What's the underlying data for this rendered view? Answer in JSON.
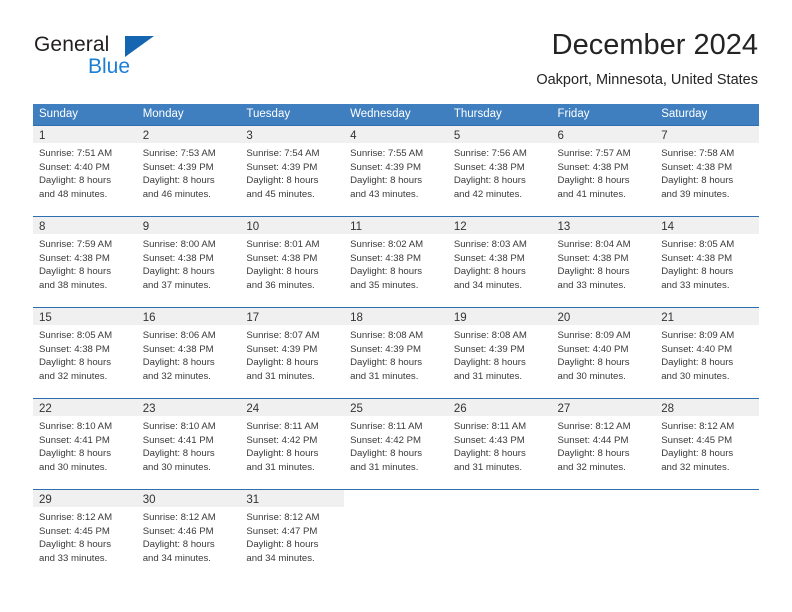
{
  "brand": {
    "name_part1": "General",
    "name_part2": "Blue",
    "triangle_icon": "triangle-logo-icon",
    "color_primary": "#1565b0",
    "color_secondary": "#1b7fd4"
  },
  "header": {
    "title": "December 2024",
    "location": "Oakport, Minnesota, United States"
  },
  "calendar": {
    "accent_color": "#3f7fbf",
    "daynum_bg": "#f0f0f0",
    "weekday_headers": [
      "Sunday",
      "Monday",
      "Tuesday",
      "Wednesday",
      "Thursday",
      "Friday",
      "Saturday"
    ],
    "weeks": [
      [
        {
          "day": "1",
          "sunrise": "Sunrise: 7:51 AM",
          "sunset": "Sunset: 4:40 PM",
          "daylight_line1": "Daylight: 8 hours",
          "daylight_line2": "and 48 minutes."
        },
        {
          "day": "2",
          "sunrise": "Sunrise: 7:53 AM",
          "sunset": "Sunset: 4:39 PM",
          "daylight_line1": "Daylight: 8 hours",
          "daylight_line2": "and 46 minutes."
        },
        {
          "day": "3",
          "sunrise": "Sunrise: 7:54 AM",
          "sunset": "Sunset: 4:39 PM",
          "daylight_line1": "Daylight: 8 hours",
          "daylight_line2": "and 45 minutes."
        },
        {
          "day": "4",
          "sunrise": "Sunrise: 7:55 AM",
          "sunset": "Sunset: 4:39 PM",
          "daylight_line1": "Daylight: 8 hours",
          "daylight_line2": "and 43 minutes."
        },
        {
          "day": "5",
          "sunrise": "Sunrise: 7:56 AM",
          "sunset": "Sunset: 4:38 PM",
          "daylight_line1": "Daylight: 8 hours",
          "daylight_line2": "and 42 minutes."
        },
        {
          "day": "6",
          "sunrise": "Sunrise: 7:57 AM",
          "sunset": "Sunset: 4:38 PM",
          "daylight_line1": "Daylight: 8 hours",
          "daylight_line2": "and 41 minutes."
        },
        {
          "day": "7",
          "sunrise": "Sunrise: 7:58 AM",
          "sunset": "Sunset: 4:38 PM",
          "daylight_line1": "Daylight: 8 hours",
          "daylight_line2": "and 39 minutes."
        }
      ],
      [
        {
          "day": "8",
          "sunrise": "Sunrise: 7:59 AM",
          "sunset": "Sunset: 4:38 PM",
          "daylight_line1": "Daylight: 8 hours",
          "daylight_line2": "and 38 minutes."
        },
        {
          "day": "9",
          "sunrise": "Sunrise: 8:00 AM",
          "sunset": "Sunset: 4:38 PM",
          "daylight_line1": "Daylight: 8 hours",
          "daylight_line2": "and 37 minutes."
        },
        {
          "day": "10",
          "sunrise": "Sunrise: 8:01 AM",
          "sunset": "Sunset: 4:38 PM",
          "daylight_line1": "Daylight: 8 hours",
          "daylight_line2": "and 36 minutes."
        },
        {
          "day": "11",
          "sunrise": "Sunrise: 8:02 AM",
          "sunset": "Sunset: 4:38 PM",
          "daylight_line1": "Daylight: 8 hours",
          "daylight_line2": "and 35 minutes."
        },
        {
          "day": "12",
          "sunrise": "Sunrise: 8:03 AM",
          "sunset": "Sunset: 4:38 PM",
          "daylight_line1": "Daylight: 8 hours",
          "daylight_line2": "and 34 minutes."
        },
        {
          "day": "13",
          "sunrise": "Sunrise: 8:04 AM",
          "sunset": "Sunset: 4:38 PM",
          "daylight_line1": "Daylight: 8 hours",
          "daylight_line2": "and 33 minutes."
        },
        {
          "day": "14",
          "sunrise": "Sunrise: 8:05 AM",
          "sunset": "Sunset: 4:38 PM",
          "daylight_line1": "Daylight: 8 hours",
          "daylight_line2": "and 33 minutes."
        }
      ],
      [
        {
          "day": "15",
          "sunrise": "Sunrise: 8:05 AM",
          "sunset": "Sunset: 4:38 PM",
          "daylight_line1": "Daylight: 8 hours",
          "daylight_line2": "and 32 minutes."
        },
        {
          "day": "16",
          "sunrise": "Sunrise: 8:06 AM",
          "sunset": "Sunset: 4:38 PM",
          "daylight_line1": "Daylight: 8 hours",
          "daylight_line2": "and 32 minutes."
        },
        {
          "day": "17",
          "sunrise": "Sunrise: 8:07 AM",
          "sunset": "Sunset: 4:39 PM",
          "daylight_line1": "Daylight: 8 hours",
          "daylight_line2": "and 31 minutes."
        },
        {
          "day": "18",
          "sunrise": "Sunrise: 8:08 AM",
          "sunset": "Sunset: 4:39 PM",
          "daylight_line1": "Daylight: 8 hours",
          "daylight_line2": "and 31 minutes."
        },
        {
          "day": "19",
          "sunrise": "Sunrise: 8:08 AM",
          "sunset": "Sunset: 4:39 PM",
          "daylight_line1": "Daylight: 8 hours",
          "daylight_line2": "and 31 minutes."
        },
        {
          "day": "20",
          "sunrise": "Sunrise: 8:09 AM",
          "sunset": "Sunset: 4:40 PM",
          "daylight_line1": "Daylight: 8 hours",
          "daylight_line2": "and 30 minutes."
        },
        {
          "day": "21",
          "sunrise": "Sunrise: 8:09 AM",
          "sunset": "Sunset: 4:40 PM",
          "daylight_line1": "Daylight: 8 hours",
          "daylight_line2": "and 30 minutes."
        }
      ],
      [
        {
          "day": "22",
          "sunrise": "Sunrise: 8:10 AM",
          "sunset": "Sunset: 4:41 PM",
          "daylight_line1": "Daylight: 8 hours",
          "daylight_line2": "and 30 minutes."
        },
        {
          "day": "23",
          "sunrise": "Sunrise: 8:10 AM",
          "sunset": "Sunset: 4:41 PM",
          "daylight_line1": "Daylight: 8 hours",
          "daylight_line2": "and 30 minutes."
        },
        {
          "day": "24",
          "sunrise": "Sunrise: 8:11 AM",
          "sunset": "Sunset: 4:42 PM",
          "daylight_line1": "Daylight: 8 hours",
          "daylight_line2": "and 31 minutes."
        },
        {
          "day": "25",
          "sunrise": "Sunrise: 8:11 AM",
          "sunset": "Sunset: 4:42 PM",
          "daylight_line1": "Daylight: 8 hours",
          "daylight_line2": "and 31 minutes."
        },
        {
          "day": "26",
          "sunrise": "Sunrise: 8:11 AM",
          "sunset": "Sunset: 4:43 PM",
          "daylight_line1": "Daylight: 8 hours",
          "daylight_line2": "and 31 minutes."
        },
        {
          "day": "27",
          "sunrise": "Sunrise: 8:12 AM",
          "sunset": "Sunset: 4:44 PM",
          "daylight_line1": "Daylight: 8 hours",
          "daylight_line2": "and 32 minutes."
        },
        {
          "day": "28",
          "sunrise": "Sunrise: 8:12 AM",
          "sunset": "Sunset: 4:45 PM",
          "daylight_line1": "Daylight: 8 hours",
          "daylight_line2": "and 32 minutes."
        }
      ],
      [
        {
          "day": "29",
          "sunrise": "Sunrise: 8:12 AM",
          "sunset": "Sunset: 4:45 PM",
          "daylight_line1": "Daylight: 8 hours",
          "daylight_line2": "and 33 minutes."
        },
        {
          "day": "30",
          "sunrise": "Sunrise: 8:12 AM",
          "sunset": "Sunset: 4:46 PM",
          "daylight_line1": "Daylight: 8 hours",
          "daylight_line2": "and 34 minutes."
        },
        {
          "day": "31",
          "sunrise": "Sunrise: 8:12 AM",
          "sunset": "Sunset: 4:47 PM",
          "daylight_line1": "Daylight: 8 hours",
          "daylight_line2": "and 34 minutes."
        },
        {
          "day": "",
          "sunrise": "",
          "sunset": "",
          "daylight_line1": "",
          "daylight_line2": ""
        },
        {
          "day": "",
          "sunrise": "",
          "sunset": "",
          "daylight_line1": "",
          "daylight_line2": ""
        },
        {
          "day": "",
          "sunrise": "",
          "sunset": "",
          "daylight_line1": "",
          "daylight_line2": ""
        },
        {
          "day": "",
          "sunrise": "",
          "sunset": "",
          "daylight_line1": "",
          "daylight_line2": ""
        }
      ]
    ]
  }
}
